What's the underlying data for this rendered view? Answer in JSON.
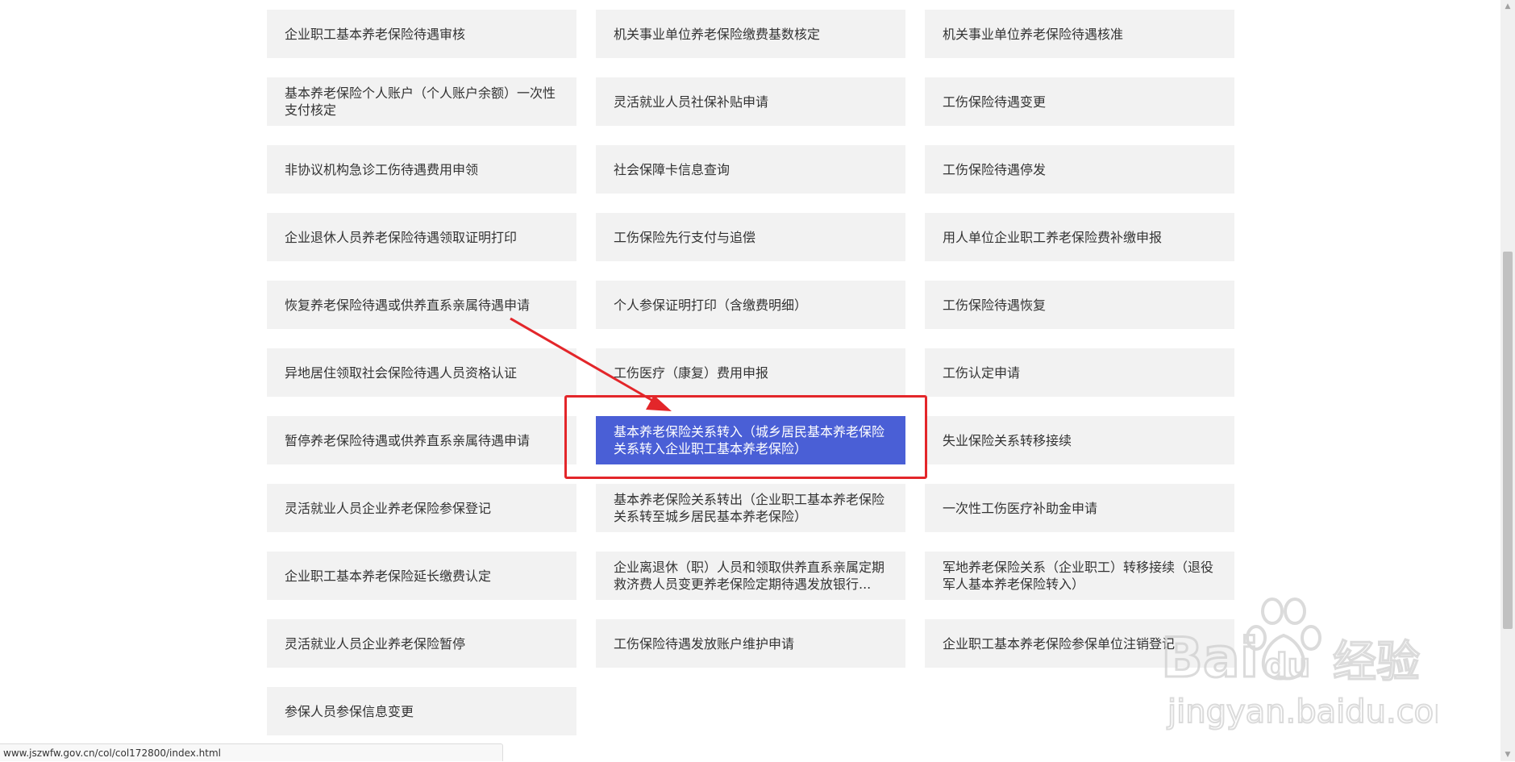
{
  "services": [
    {
      "label": "企业职工基本养老保险待遇审核"
    },
    {
      "label": "机关事业单位养老保险缴费基数核定"
    },
    {
      "label": "机关事业单位养老保险待遇核准"
    },
    {
      "label": "基本养老保险个人账户（个人账户余额）一次性支付核定"
    },
    {
      "label": "灵活就业人员社保补贴申请"
    },
    {
      "label": "工伤保险待遇变更"
    },
    {
      "label": "非协议机构急诊工伤待遇费用申领"
    },
    {
      "label": "社会保障卡信息查询"
    },
    {
      "label": "工伤保险待遇停发"
    },
    {
      "label": "企业退休人员养老保险待遇领取证明打印"
    },
    {
      "label": "工伤保险先行支付与追偿"
    },
    {
      "label": "用人单位企业职工养老保险费补缴申报"
    },
    {
      "label": "恢复养老保险待遇或供养直系亲属待遇申请"
    },
    {
      "label": "个人参保证明打印（含缴费明细）"
    },
    {
      "label": "工伤保险待遇恢复"
    },
    {
      "label": "异地居住领取社会保险待遇人员资格认证"
    },
    {
      "label": "工伤医疗（康复）费用申报"
    },
    {
      "label": "工伤认定申请"
    },
    {
      "label": "暂停养老保险待遇或供养直系亲属待遇申请"
    },
    {
      "label": "基本养老保险关系转入（城乡居民基本养老保险关系转入企业职工基本养老保险）"
    },
    {
      "label": "失业保险关系转移接续"
    },
    {
      "label": "灵活就业人员企业养老保险参保登记"
    },
    {
      "label": "基本养老保险关系转出（企业职工基本养老保险关系转至城乡居民基本养老保险）"
    },
    {
      "label": "一次性工伤医疗补助金申请"
    },
    {
      "label": "企业职工基本养老保险延长缴费认定"
    },
    {
      "label": "企业离退休（职）人员和领取供养直系亲属定期救济费人员变更养老保险定期待遇发放银行..."
    },
    {
      "label": "军地养老保险关系（企业职工）转移接续（退役军人基本养老保险转入）"
    },
    {
      "label": "灵活就业人员企业养老保险暂停"
    },
    {
      "label": "工伤保险待遇发放账户维护申请"
    },
    {
      "label": "企业职工基本养老保险参保单位注销登记"
    },
    {
      "label": "参保人员参保信息变更"
    }
  ],
  "highlighted_index": 19,
  "status_url": "www.jszwfw.gov.cn/col/col172800/index.html",
  "watermark": {
    "brand_latin": "Bai",
    "brand_du": "du",
    "brand_cn": "经验",
    "domain": "jingyan.baidu.com"
  },
  "colors": {
    "tile_bg": "#f2f2f2",
    "highlight_bg": "#4a5fd6",
    "annotation_red": "#e3262a"
  }
}
